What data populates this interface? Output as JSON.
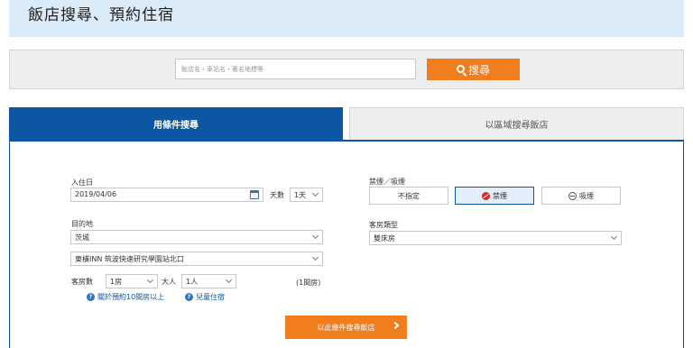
{
  "header": {
    "title": "飯店搜尋、預約住宿"
  },
  "search": {
    "placeholder": "飯店名・車站名・著名地標等",
    "button_label": "搜尋"
  },
  "tabs": [
    {
      "label": "用條件搜尋",
      "active": true
    },
    {
      "label": "以區域搜尋飯店",
      "active": false
    }
  ],
  "form": {
    "checkin_label": "入住日",
    "checkin_value": "2019/04/06",
    "nights_label": "天數",
    "nights_value": "1天",
    "destination_label": "目的地",
    "prefecture_value": "茨城",
    "hotel_value": "東橫INN 筑波快速研究學園站北口",
    "rooms_label": "客房數",
    "rooms_value": "1房",
    "adults_label": "大人",
    "adults_value": "1人",
    "rooms_summary": "(1間房)",
    "help_links": [
      "關於預約10間房以上",
      "兒童住宿"
    ],
    "smoking_label": "禁煙／吸煙",
    "smoking_options": [
      "不指定",
      "禁煙",
      "吸煙"
    ],
    "smoking_selected": "禁煙",
    "roomtype_label": "客房類型",
    "roomtype_value": "雙床房",
    "submit_label": "以此條件搜尋飯店"
  },
  "colors": {
    "primary_blue": "#0c56a3",
    "accent_orange": "#f07d1e",
    "header_bg": "#dbeaf7"
  }
}
